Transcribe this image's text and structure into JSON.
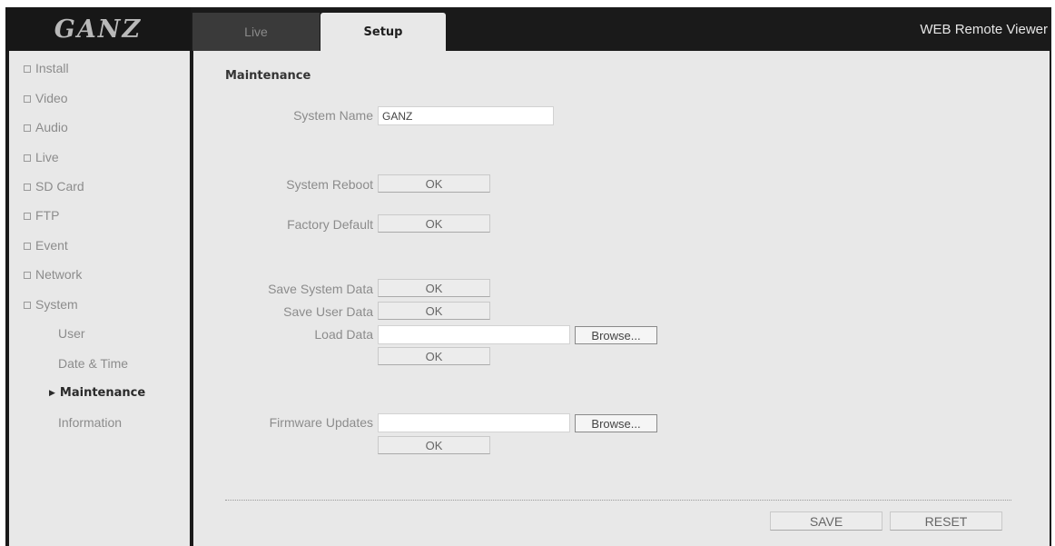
{
  "logo": {
    "text": "GANZ"
  },
  "tabs": {
    "live": "Live",
    "setup": "Setup"
  },
  "app_title": "WEB Remote Viewer",
  "sidebar": {
    "items": [
      {
        "label": "Install"
      },
      {
        "label": "Video"
      },
      {
        "label": "Audio"
      },
      {
        "label": "Live"
      },
      {
        "label": "SD Card"
      },
      {
        "label": "FTP"
      },
      {
        "label": "Event"
      },
      {
        "label": "Network"
      },
      {
        "label": "System"
      }
    ],
    "system_sub": [
      {
        "label": "User"
      },
      {
        "label": "Date & Time"
      },
      {
        "label": "Maintenance",
        "active": true
      },
      {
        "label": "Information"
      }
    ]
  },
  "main": {
    "title": "Maintenance",
    "system_name_label": "System Name",
    "system_name_value": "GANZ",
    "system_reboot_label": "System Reboot",
    "factory_default_label": "Factory Default",
    "save_system_data_label": "Save System Data",
    "save_user_data_label": "Save User Data",
    "load_data_label": "Load Data",
    "firmware_updates_label": "Firmware Updates",
    "ok_label": "OK",
    "browse_label": "Browse..."
  },
  "footer": {
    "save_label": "SAVE",
    "reset_label": "RESET"
  }
}
